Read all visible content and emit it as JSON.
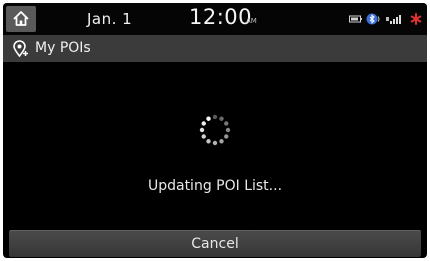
{
  "status_bar": {
    "date": "Jan.  1",
    "time": "12:00",
    "ampm": "AM",
    "icons": [
      "battery-icon",
      "bluetooth-icon",
      "signal-icon",
      "alert-icon"
    ],
    "alert_color": "#e03030"
  },
  "header": {
    "title": "My POIs",
    "icon": "poi-pin-icon"
  },
  "main": {
    "loading_text": "Updating POI List...",
    "spinner": "loading-spinner-icon"
  },
  "footer": {
    "cancel_label": "Cancel"
  }
}
